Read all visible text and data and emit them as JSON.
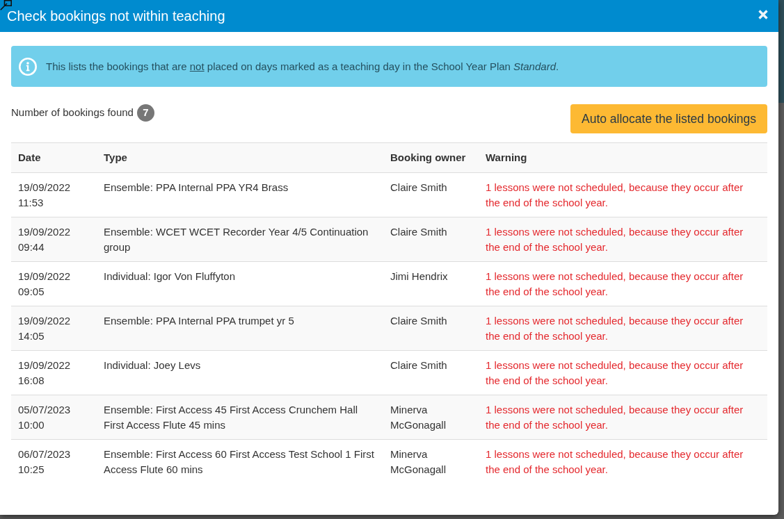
{
  "dialog": {
    "title": "Check bookings not within teaching"
  },
  "info_alert": {
    "segments": [
      {
        "text": "This lists the bookings that are ",
        "kind": "normal"
      },
      {
        "text": "not",
        "kind": "underlined"
      },
      {
        "text": " placed on days marked as a teaching day in the School Year Plan ",
        "kind": "normal"
      },
      {
        "text": "Standard",
        "kind": "emphasized"
      },
      {
        "text": ".",
        "kind": "normal"
      }
    ]
  },
  "bookings_found": {
    "label": "Number of bookings found",
    "count": "7"
  },
  "auto_allocate_button": {
    "label": "Auto allocate the listed bookings"
  },
  "table": {
    "columns": [
      "Date",
      "Type",
      "Booking owner",
      "Warning"
    ],
    "rows": [
      {
        "date": "19/09/2022 11:53",
        "type": "Ensemble: PPA Internal PPA YR4 Brass",
        "booking_owner": "Claire Smith",
        "warning": "1 lessons were not scheduled, because they occur after the end of the school year."
      },
      {
        "date": "19/09/2022 09:44",
        "type": "Ensemble: WCET WCET Recorder Year 4/5 Continuation group",
        "booking_owner": "Claire Smith",
        "warning": "1 lessons were not scheduled, because they occur after the end of the school year."
      },
      {
        "date": "19/09/2022 09:05",
        "type": "Individual: Igor Von Fluffyton",
        "booking_owner": "Jimi Hendrix",
        "warning": "1 lessons were not scheduled, because they occur after the end of the school year."
      },
      {
        "date": "19/09/2022 14:05",
        "type": "Ensemble: PPA Internal PPA trumpet yr 5",
        "booking_owner": "Claire Smith",
        "warning": "1 lessons were not scheduled, because they occur after the end of the school year."
      },
      {
        "date": "19/09/2022 16:08",
        "type": "Individual: Joey Levs",
        "booking_owner": "Claire Smith",
        "warning": "1 lessons were not scheduled, because they occur after the end of the school year."
      },
      {
        "date": "05/07/2023 10:00",
        "type": "Ensemble: First Access 45 First Access Crunchem Hall First Access Flute 45 mins",
        "booking_owner": "Minerva McGonagall",
        "warning": "1 lessons were not scheduled, because they occur after the end of the school year."
      },
      {
        "date": "06/07/2023 10:25",
        "type": "Ensemble: First Access 60 First Access Test School 1 First Access Flute 60 mins",
        "booking_owner": "Minerva McGonagall",
        "warning": "1 lessons were not scheduled, because they occur after the end of the school year."
      }
    ]
  }
}
